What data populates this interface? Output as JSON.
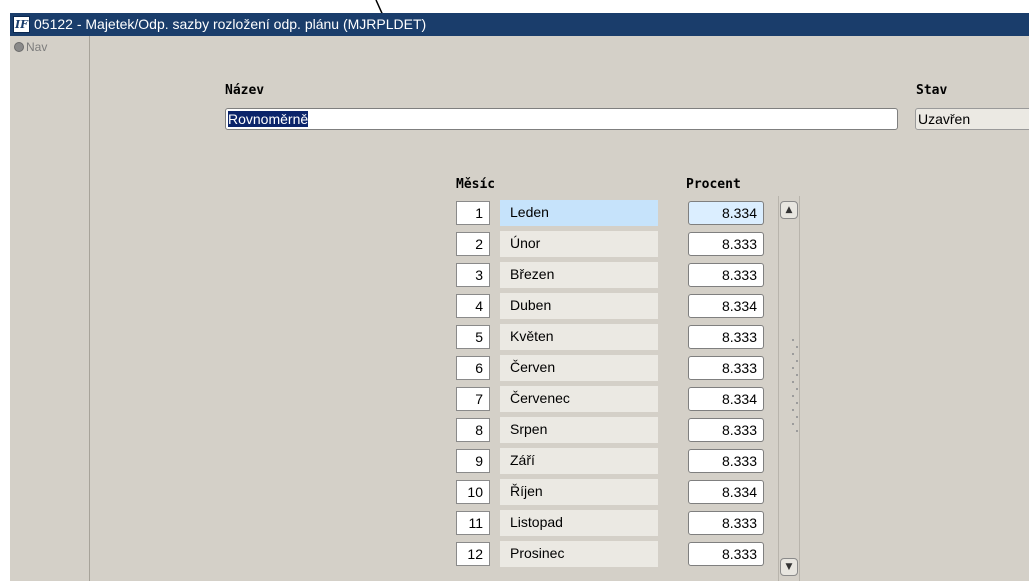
{
  "window": {
    "title": "05122 - Majetek/Odp. sazby rozložení odp. plánu (MJRPLDET)",
    "app_icon_text": "IF"
  },
  "nav": {
    "label": "Nav"
  },
  "form": {
    "name_label": "Název",
    "name_value": "Rovnoměrně",
    "status_label": "Stav",
    "status_value": "Uzavřen",
    "month_header": "Měsíc",
    "percent_header": "Procent"
  },
  "rows": [
    {
      "num": "1",
      "month": "Leden",
      "percent": "8.334"
    },
    {
      "num": "2",
      "month": "Únor",
      "percent": "8.333"
    },
    {
      "num": "3",
      "month": "Březen",
      "percent": "8.333"
    },
    {
      "num": "4",
      "month": "Duben",
      "percent": "8.334"
    },
    {
      "num": "5",
      "month": "Květen",
      "percent": "8.333"
    },
    {
      "num": "6",
      "month": "Červen",
      "percent": "8.333"
    },
    {
      "num": "7",
      "month": "Červenec",
      "percent": "8.334"
    },
    {
      "num": "8",
      "month": "Srpen",
      "percent": "8.333"
    },
    {
      "num": "9",
      "month": "Září",
      "percent": "8.333"
    },
    {
      "num": "10",
      "month": "Říjen",
      "percent": "8.334"
    },
    {
      "num": "11",
      "month": "Listopad",
      "percent": "8.333"
    },
    {
      "num": "12",
      "month": "Prosinec",
      "percent": "8.333"
    }
  ],
  "colors": {
    "titlebar": "#1a3d6b",
    "selection": "#0b246a",
    "active_row": "#c6e3fb"
  }
}
